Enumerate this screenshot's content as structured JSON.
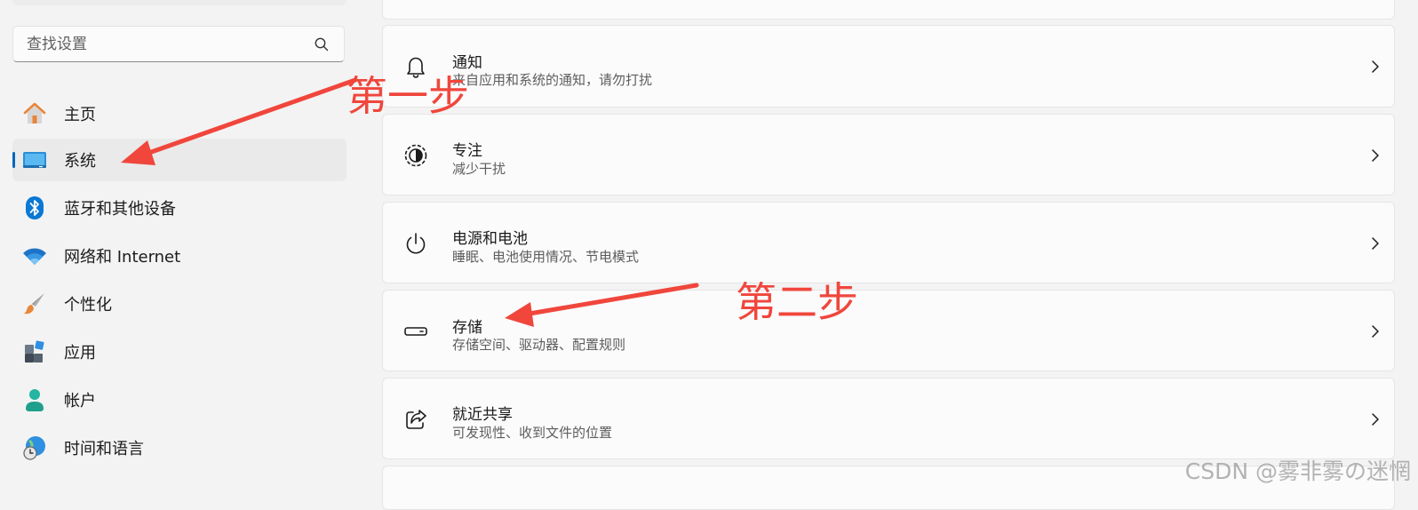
{
  "search": {
    "placeholder": "查找设置"
  },
  "sidebar": {
    "items": [
      {
        "label": "主页",
        "icon": "home-icon"
      },
      {
        "label": "系统",
        "icon": "system-display-icon",
        "selected": true
      },
      {
        "label": "蓝牙和其他设备",
        "icon": "bluetooth-icon"
      },
      {
        "label": "网络和 Internet",
        "icon": "wifi-icon"
      },
      {
        "label": "个性化",
        "icon": "paintbrush-icon"
      },
      {
        "label": "应用",
        "icon": "apps-icon"
      },
      {
        "label": "帐户",
        "icon": "account-icon"
      },
      {
        "label": "时间和语言",
        "icon": "globe-clock-icon"
      }
    ]
  },
  "main": {
    "cards": [
      {
        "title": "通知",
        "subtitle": "来自应用和系统的通知，请勿打扰",
        "icon": "bell-icon"
      },
      {
        "title": "专注",
        "subtitle": "减少干扰",
        "icon": "focus-icon"
      },
      {
        "title": "电源和电池",
        "subtitle": "睡眠、电池使用情况、节电模式",
        "icon": "power-icon"
      },
      {
        "title": "存储",
        "subtitle": "存储空间、驱动器、配置规则",
        "icon": "storage-drive-icon"
      },
      {
        "title": "就近共享",
        "subtitle": "可发现性、收到文件的位置",
        "icon": "share-icon"
      }
    ]
  },
  "annotations": {
    "step1": "第一步",
    "step2": "第二步",
    "color": "#f0463c"
  },
  "watermark": "CSDN @雾非雾の迷惘",
  "colors": {
    "accent": "#0067c0",
    "card_bg": "#fbfbfb",
    "page_bg": "#f3f3f3"
  }
}
